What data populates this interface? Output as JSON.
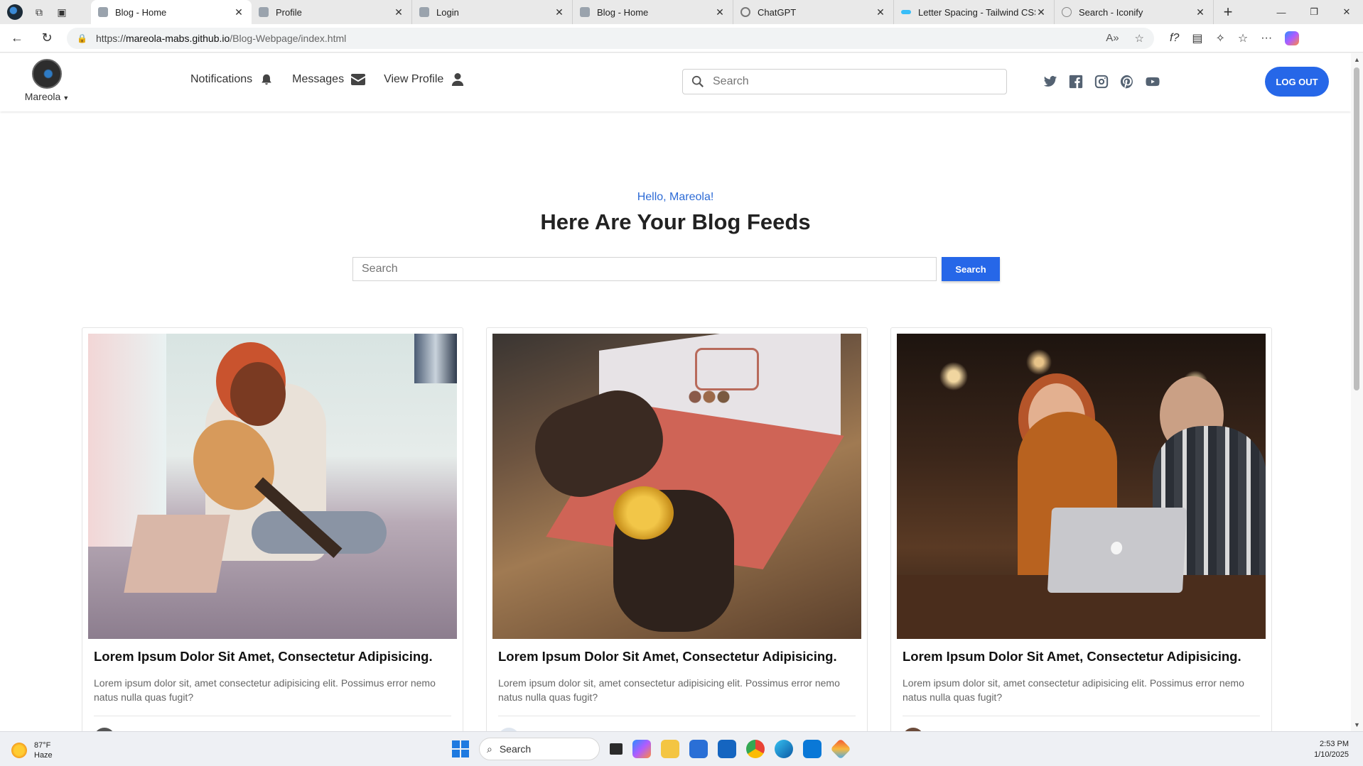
{
  "browser": {
    "tabs": [
      {
        "title": "Blog - Home",
        "favicon": "page-icon",
        "active": true
      },
      {
        "title": "Profile",
        "favicon": "page-icon",
        "active": false
      },
      {
        "title": "Login",
        "favicon": "page-icon",
        "active": false
      },
      {
        "title": "Blog - Home",
        "favicon": "page-icon",
        "active": false
      },
      {
        "title": "ChatGPT",
        "favicon": "chatgpt-icon",
        "active": false
      },
      {
        "title": "Letter Spacing - Tailwind CSS",
        "favicon": "tailwind-icon",
        "active": false
      },
      {
        "title": "Search - Iconify",
        "favicon": "iconify-icon",
        "active": false
      }
    ],
    "url_prefix": "https://",
    "url_host": "mareola-mabs.github.io",
    "url_path": "/Blog-Webpage/index.html"
  },
  "site": {
    "user": {
      "name": "Mareola"
    },
    "nav": [
      {
        "label": "Notifications",
        "icon": "bell-icon"
      },
      {
        "label": "Messages",
        "icon": "envelope-icon"
      },
      {
        "label": "View Profile",
        "icon": "user-icon"
      }
    ],
    "header_search_placeholder": "Search",
    "socials": [
      "twitter-icon",
      "facebook-icon",
      "instagram-icon",
      "pinterest-icon",
      "youtube-icon"
    ],
    "logout_label": "LOG OUT",
    "accent_color": "#2667e8"
  },
  "hero": {
    "greeting": "Hello, Mareola!",
    "title": "Here Are Your Blog Feeds",
    "search_placeholder": "Search",
    "search_button": "Search"
  },
  "posts": [
    {
      "title": "Lorem Ipsum Dolor Sit Amet, Consectetur Adipisicing.",
      "excerpt": "Lorem ipsum dolor sit, amet consectetur adipisicing elit. Possimus error nemo natus nulla quas fugit?"
    },
    {
      "title": "Lorem Ipsum Dolor Sit Amet, Consectetur Adipisicing.",
      "excerpt": "Lorem ipsum dolor sit, amet consectetur adipisicing elit. Possimus error nemo natus nulla quas fugit?"
    },
    {
      "title": "Lorem Ipsum Dolor Sit Amet, Consectetur Adipisicing.",
      "excerpt": "Lorem ipsum dolor sit, amet consectetur adipisicing elit. Possimus error nemo natus nulla quas fugit?"
    }
  ],
  "taskbar": {
    "weather_temp": "87°F",
    "weather_desc": "Haze",
    "search_label": "Search",
    "time": "2:53 PM",
    "date": "1/10/2025"
  }
}
